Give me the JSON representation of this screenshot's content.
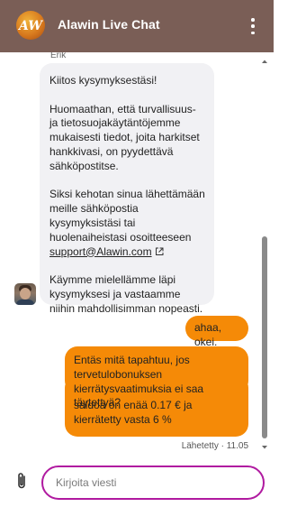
{
  "header": {
    "logo_text": "AW",
    "title": "Alawin Live Chat",
    "menu_icon": "more-vertical-icon"
  },
  "messages": {
    "cut_author": "Erik",
    "bot": {
      "line1": "Kiitos kysymyksestäsi!",
      "para2": "Huomaathan, että turvallisuus- ja tietosuojakäytäntöjemme mukaisesti tiedot, joita harkitset hankkivasi, on pyydettävä sähköpostitse.",
      "para3_prefix": "Siksi kehotan sinua lähettämään meille sähköpostia kysymyksistäsi tai huolenaiheistasi osoitteeseen",
      "email": "support@Alawin.com",
      "para4": "Käymme mielellämme läpi kysymyksesi ja vastaamme niihin mahdollisimman nopeasti."
    },
    "user": [
      "ahaa, okei.",
      "Entäs mitä tapahtuu, jos tervetulobonuksen kierrätysvaatimuksia ei saa täytettyä?",
      "saldoa on enää 0.17 € ja kierrätetty vasta 6 %"
    ],
    "status": "Lähetetty · 11.05"
  },
  "composer": {
    "placeholder": "Kirjoita viesti",
    "value": ""
  },
  "colors": {
    "header": "#7a5e56",
    "user_bubble": "#f58a07",
    "bot_bubble": "#f1f1f4",
    "input_border": "#b01aa0"
  }
}
